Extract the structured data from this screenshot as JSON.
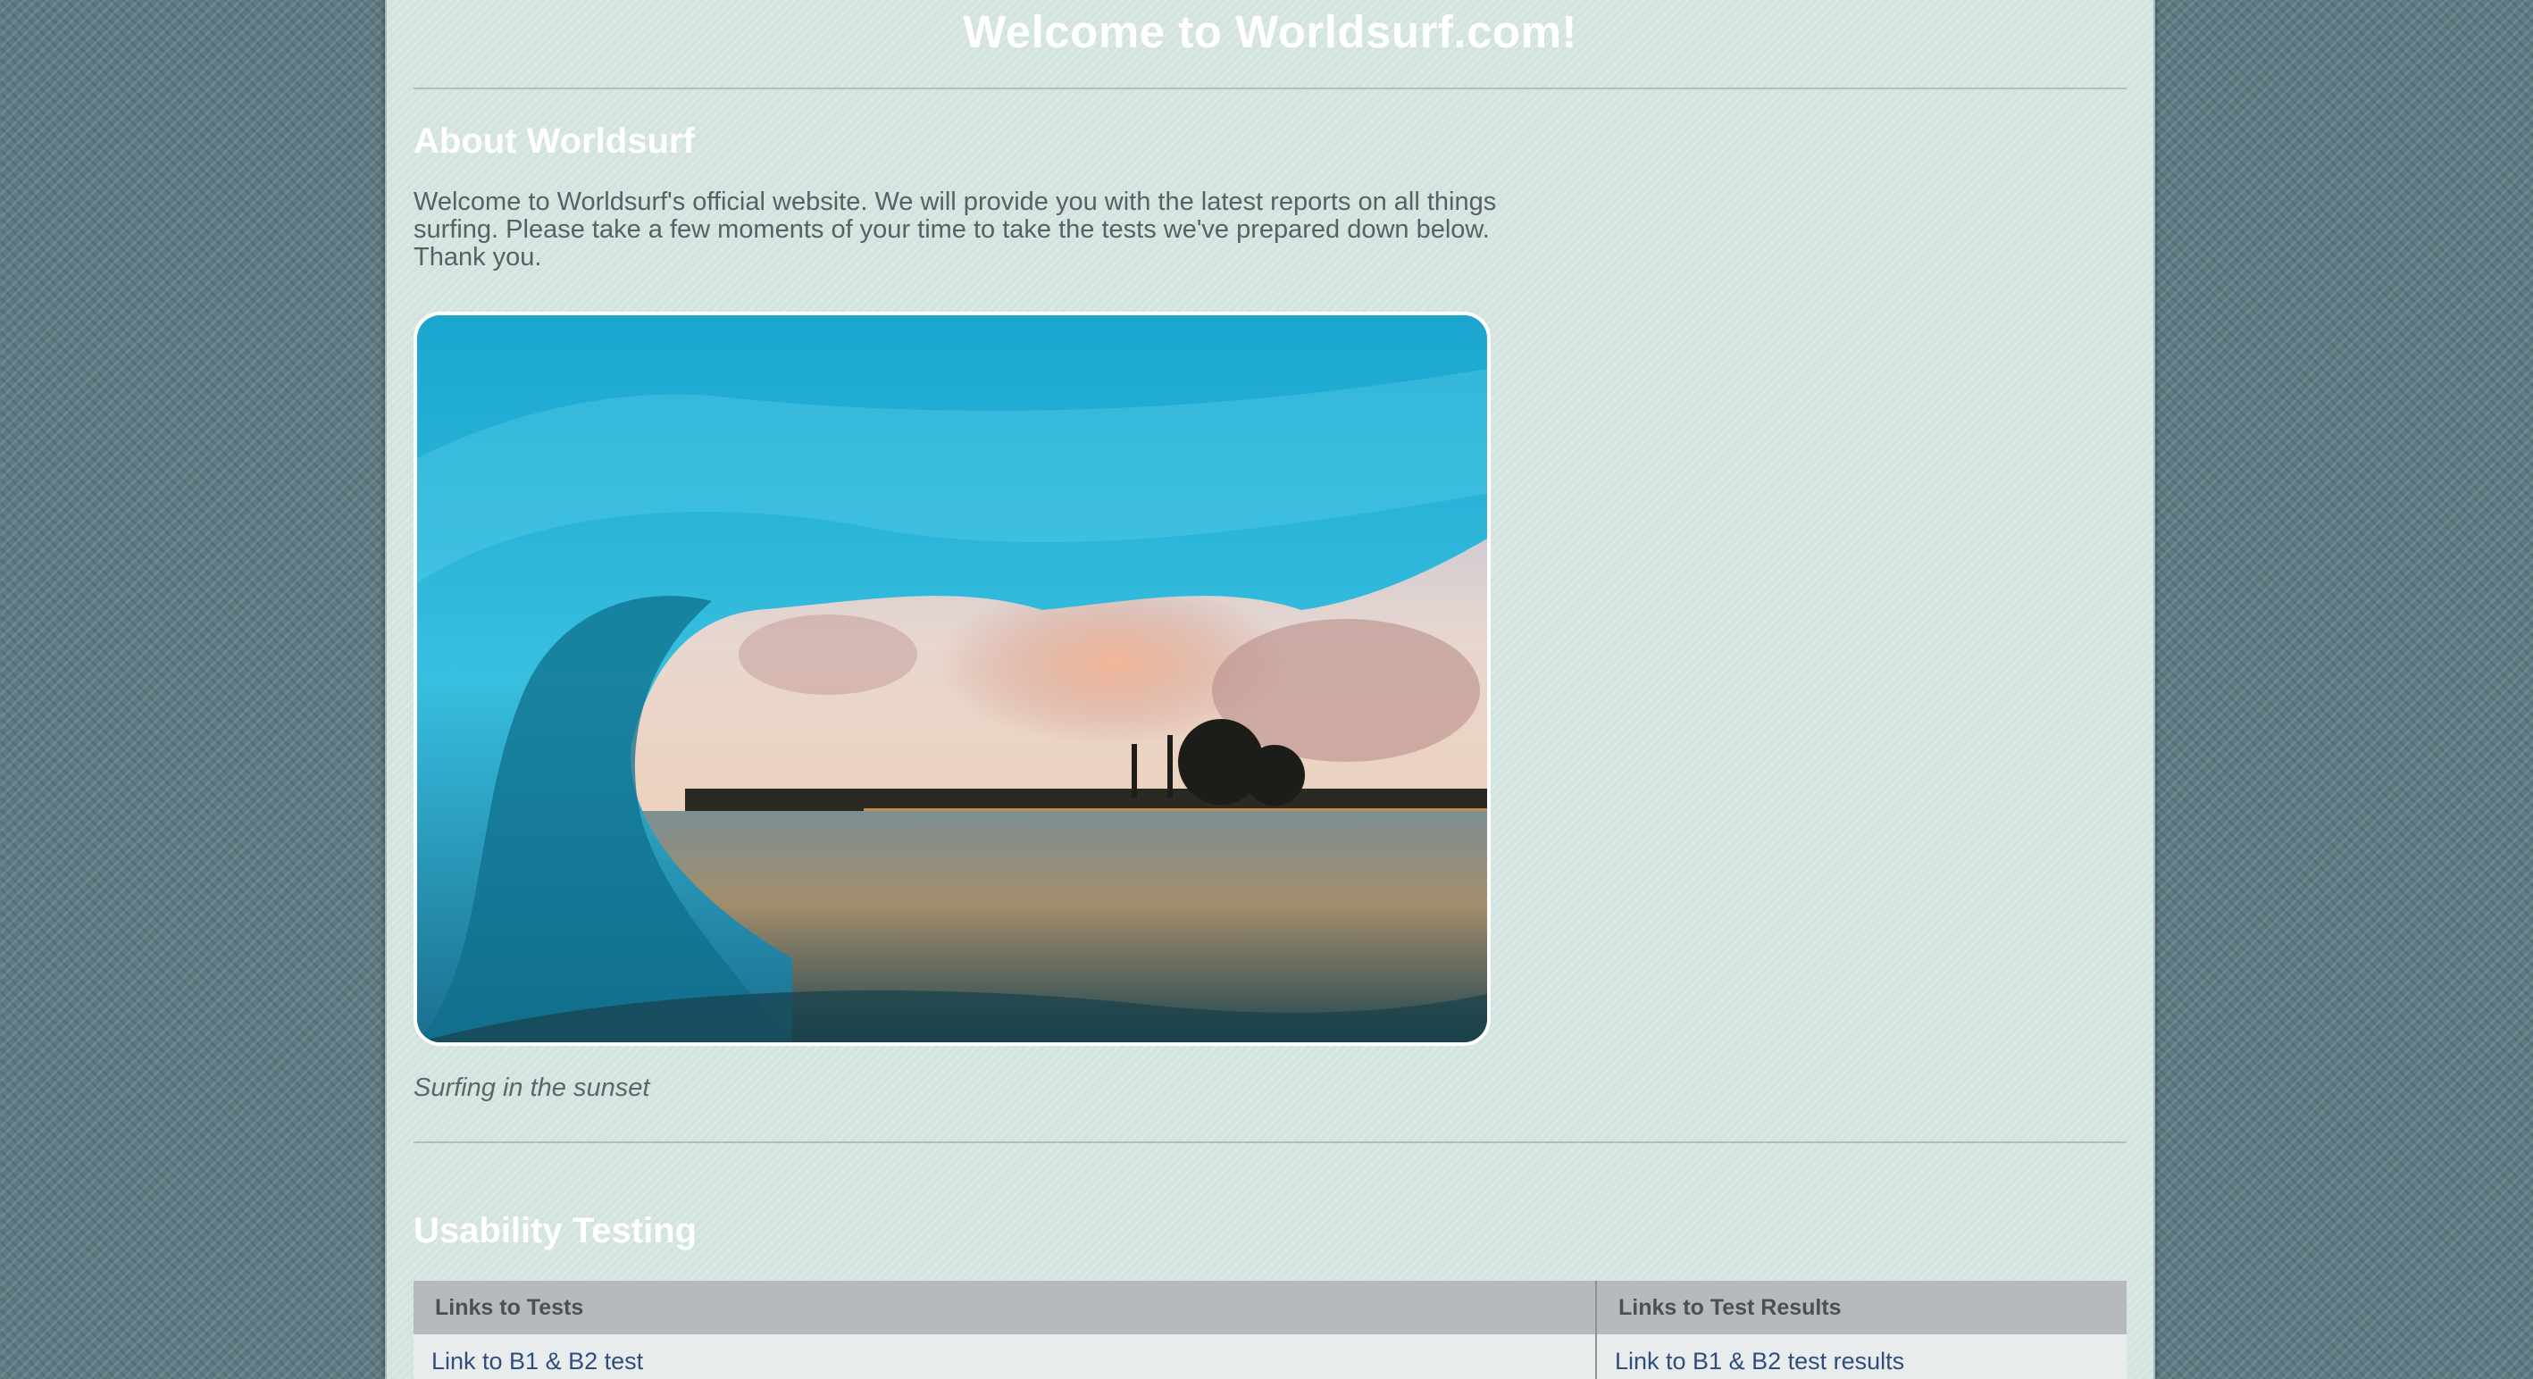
{
  "header": {
    "title": "Welcome to Worldsurf.com!"
  },
  "about": {
    "heading": "About Worldsurf",
    "text": "Welcome to Worldsurf's official website. We will provide you with the latest reports on all things surfing. Please take a few moments of your time to take the tests we've prepared down below. Thank you.",
    "image_caption": "Surfing in the sunset"
  },
  "usability": {
    "heading": "Usability Testing",
    "table": {
      "columns": [
        "Links to Tests",
        "Links to Test Results"
      ],
      "rows": [
        [
          "Link to B1 & B2 test",
          "Link to B1 & B2 test results"
        ]
      ]
    }
  },
  "colors": {
    "page_background": "#5f7a83",
    "content_background": "#d3e3df",
    "heading_text": "#ffffff",
    "body_text": "#5a5f62",
    "table_header": "#b7babd",
    "link": "#2f4d7e"
  }
}
